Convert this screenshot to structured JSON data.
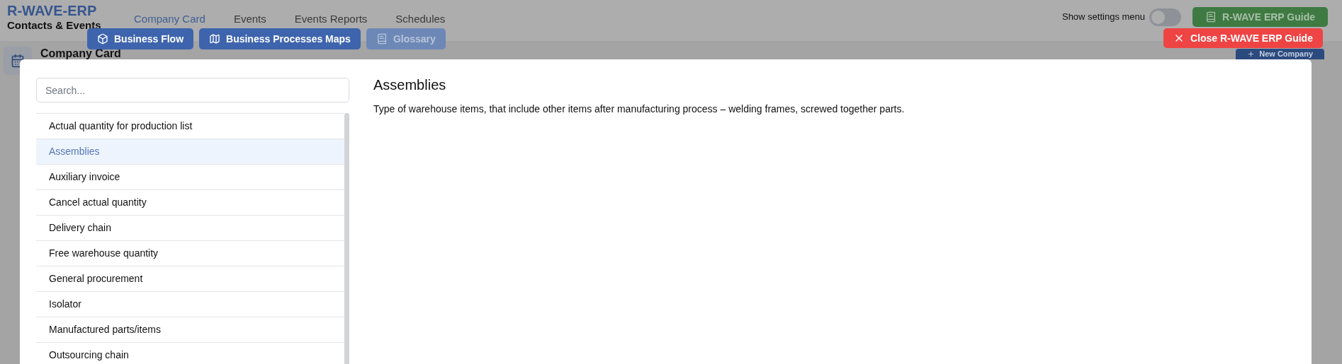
{
  "app": {
    "title": "R-WAVE-ERP",
    "subtitle": "Contacts & Events"
  },
  "nav": [
    {
      "label": "Company Card",
      "selected": true
    },
    {
      "label": "Events",
      "selected": false
    },
    {
      "label": "Events Reports",
      "selected": false
    },
    {
      "label": "Schedules",
      "selected": false
    }
  ],
  "settings_toggle": {
    "label": "Show settings menu",
    "on": false
  },
  "guide_button": "R-WAVE ERP Guide",
  "page": {
    "title": "Company Card",
    "new_button": "New Company"
  },
  "guide": {
    "tabs": [
      {
        "label": "Business Flow",
        "selected": false
      },
      {
        "label": "Business Processes Maps",
        "selected": false
      },
      {
        "label": "Glossary",
        "selected": true
      }
    ],
    "close_button": "Close R-WAVE ERP Guide",
    "search": {
      "placeholder": "Search..."
    },
    "entries": [
      {
        "label": "Actual quantity for production list",
        "selected": false
      },
      {
        "label": "Assemblies",
        "selected": true
      },
      {
        "label": "Auxiliary invoice",
        "selected": false
      },
      {
        "label": "Cancel actual quantity",
        "selected": false
      },
      {
        "label": "Delivery chain",
        "selected": false
      },
      {
        "label": "Free warehouse quantity",
        "selected": false
      },
      {
        "label": "General procurement",
        "selected": false
      },
      {
        "label": "Isolator",
        "selected": false
      },
      {
        "label": "Manufactured parts/items",
        "selected": false
      },
      {
        "label": "Outsourcing chain",
        "selected": false
      }
    ],
    "article": {
      "title": "Assemblies",
      "text": "Type of warehouse items, that include other items after manufacturing process – welding frames, screwed together parts."
    }
  }
}
